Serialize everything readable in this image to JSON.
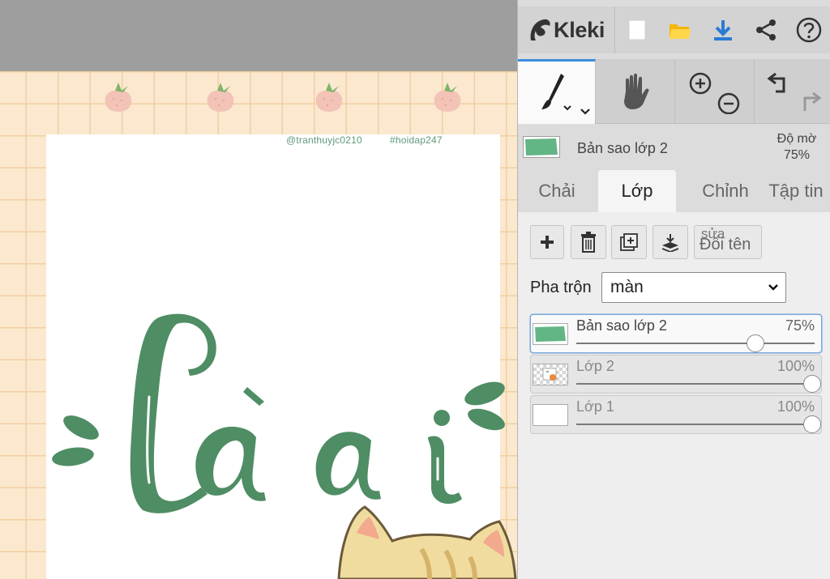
{
  "app": {
    "name": "Kleki",
    "accent_color": "#3c8dde"
  },
  "canvas": {
    "credits": {
      "author": "@tranthuyjc0210",
      "hashtag": "#hoidap247"
    },
    "lettering_color": "#4f8d64"
  },
  "topbar": {
    "icons": [
      "new-image-icon",
      "open-folder-icon",
      "download-icon",
      "share-icon",
      "help-icon"
    ]
  },
  "tools": {
    "items": [
      "brush",
      "hand",
      "zoom",
      "undo-redo"
    ]
  },
  "layer_info": {
    "name": "Bản sao lớp 2",
    "opacity_label": "Độ mờ",
    "opacity_value": "75%"
  },
  "tabs": [
    {
      "label": "Chải",
      "active": false
    },
    {
      "label": "Lớp",
      "active": true
    },
    {
      "label": "Chỉnh",
      "active": false
    },
    {
      "label": "Tập tin",
      "active": false
    }
  ],
  "layer_actions": {
    "rename_overlay": "sửa",
    "rename_label": "Đổi tên"
  },
  "blend": {
    "label": "Pha trộn",
    "value": "màn"
  },
  "layers": [
    {
      "name": "Bản sao lớp 2",
      "opacity": "75%",
      "opacity_fraction": 0.75,
      "active": true
    },
    {
      "name": "Lớp 2",
      "opacity": "100%",
      "opacity_fraction": 1.0,
      "active": false
    },
    {
      "name": "Lớp 1",
      "opacity": "100%",
      "opacity_fraction": 1.0,
      "active": false
    }
  ]
}
